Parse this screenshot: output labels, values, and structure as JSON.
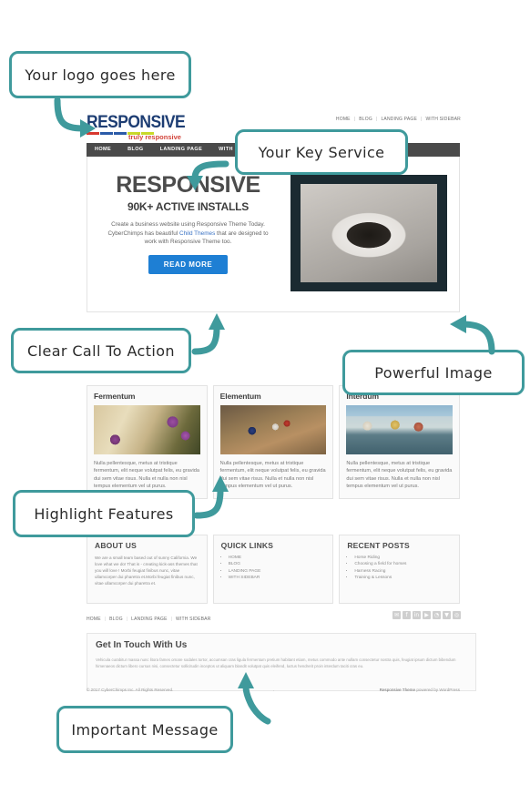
{
  "annotations": [
    {
      "id": "logo",
      "label": "Your logo goes here"
    },
    {
      "id": "key-service",
      "label": "Your Key Service"
    },
    {
      "id": "cta",
      "label": "Clear Call To Action"
    },
    {
      "id": "image",
      "label": "Powerful Image"
    },
    {
      "id": "features",
      "label": "Highlight Features"
    },
    {
      "id": "message",
      "label": "Important Message"
    }
  ],
  "site": {
    "logo": {
      "word": "RESPONSIVE",
      "tagline": "truly responsive",
      "bar_colors": [
        "#d8372e",
        "#2b5ba8",
        "#2b5ba8",
        "#c8d92a",
        "#c8d92a"
      ],
      "word_color": "#1d3d73",
      "tagline_color": "#d2443b"
    },
    "top_links": [
      "HOME",
      "BLOG",
      "LANDING PAGE",
      "WITH SIDEBAR"
    ],
    "nav": [
      "HOME",
      "BLOG",
      "LANDING PAGE",
      "WITH SIDEBAR"
    ],
    "hero": {
      "title": "RESPONSIVE",
      "subtitle": "90K+ ACTIVE INSTALLS",
      "text_before": "Create a business website using Responsive Theme Today. CyberChimps has beautiful ",
      "link": "Child Themes",
      "text_after": " that are designed to work with Responsive Theme too.",
      "button": "READ MORE",
      "button_color": "#1e7fd4",
      "image_alt": "coffee-cup-mittens-photo"
    },
    "cards": [
      {
        "title": "Fermentum",
        "image_alt": "open-book-with-lavender-photo",
        "text": "Nulla pellentesque, metus at tristique fermentum, elit neque volutpat felis, eu gravida dui sem vitae risus. Nulla et nulla non nisl tempus elementum vel ut purus."
      },
      {
        "title": "Elementum",
        "image_alt": "rustic-table-setting-photo",
        "text": "Nulla pellentesque, metus at tristique fermentum, elit neque volutpat felis, eu gravida dui sem vitae risus. Nulla et nulla non nisl tempus elementum vel ut purus."
      },
      {
        "title": "Interdum",
        "image_alt": "canal-houses-bruges-photo",
        "text": "Nulla pellentesque, metus at tristique fermentum, elit neque volutpat felis, eu gravida dui sem vitae risus. Nulla et nulla non nisl tempus elementum vel ut purus."
      }
    ],
    "widgets": {
      "about": {
        "title": "ABOUT US",
        "text": "We are a small team based out of sunny California. We love what we do! That is - creating kick-ass themes that you will love ! Morbi feugiat finibus nunc, vitae ullamcorper dui pharetra et.Morbi feugiat finibus nunc, vitae ullamcorper dui pharetra et."
      },
      "quick_links": {
        "title": "QUICK LINKS",
        "items": [
          "HOME",
          "BLOG",
          "LANDING PAGE",
          "WITH SIDEBAR"
        ]
      },
      "recent_posts": {
        "title": "RECENT POSTS",
        "items": [
          "Horse Riding",
          "Choosing a field for horses",
          "Harness Racing",
          "Training & Lessons"
        ]
      }
    },
    "subnav": [
      "HOME",
      "BLOG",
      "LANDING PAGE",
      "WITH SIDEBAR"
    ],
    "socials": [
      {
        "name": "twitter-icon",
        "glyph": "✉"
      },
      {
        "name": "facebook-icon",
        "glyph": "f"
      },
      {
        "name": "linkedin-icon",
        "glyph": "in"
      },
      {
        "name": "youtube-icon",
        "glyph": "▶"
      },
      {
        "name": "rss-icon",
        "glyph": "◔"
      },
      {
        "name": "vimeo-icon",
        "glyph": "▼"
      },
      {
        "name": "google-plus-icon",
        "glyph": "◎"
      }
    ],
    "contact": {
      "title": "Get In Touch With Us",
      "text": "Vehicula curabitur massa nunc litora fames ornare sodales tortor, accumsan cras ligula fermentum pretium habitant etiam, metus commodo ante nullam consectetur nostra quis, feugiat ipsum dictum bibendum himenaeos dictum libero cursus nisi, consectetur sollicitudin inceptos ut aliquam blandit volutpat quis eleifend, luctus hendrerit proin interdum taciti cras eu."
    },
    "footer": {
      "copyright": "© 2017 CyberChimps Inc. All Rights Reserved.",
      "middle": ".",
      "credit_prefix": "Responsive Theme",
      "credit_suffix": " powered by WordPress"
    }
  }
}
